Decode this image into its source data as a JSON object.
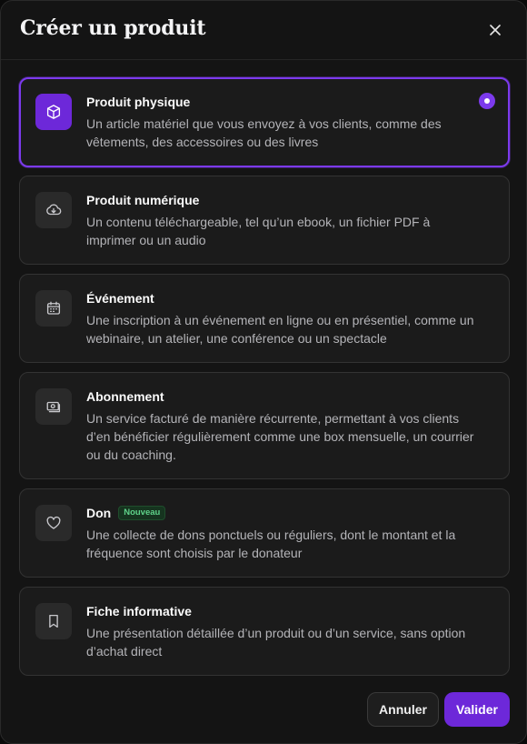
{
  "dialog": {
    "title": "Créer un produit"
  },
  "options": [
    {
      "title": "Produit physique",
      "description": "Un article matériel que vous envoyez à vos clients, comme des vêtements, des accessoires ou des livres",
      "icon": "cube-icon",
      "selected": true
    },
    {
      "title": "Produit numérique",
      "description": "Un contenu téléchargeable, tel qu’un ebook, un fichier PDF à imprimer ou un audio",
      "icon": "cloud-download-icon",
      "selected": false
    },
    {
      "title": "Événement",
      "description": "Une inscription à un événement en ligne ou en présentiel, comme un webinaire, un atelier, une conférence ou un spectacle",
      "icon": "calendar-icon",
      "selected": false
    },
    {
      "title": "Abonnement",
      "description": "Un service facturé de manière récurrente, permettant à vos clients d’en bénéficier régulièrement comme une box mensuelle, un courrier ou du coaching.",
      "icon": "money-icon",
      "selected": false
    },
    {
      "title": "Don",
      "badge": "Nouveau",
      "description": "Une collecte de dons ponctuels ou réguliers, dont le montant et la fréquence sont choisis par le donateur",
      "icon": "heart-icon",
      "selected": false
    },
    {
      "title": "Fiche informative",
      "description": "Une présentation détaillée d’un produit ou d’un service, sans option d’achat direct",
      "icon": "bookmark-icon",
      "selected": false
    }
  ],
  "footer": {
    "cancel_label": "Annuler",
    "confirm_label": "Valider"
  },
  "colors": {
    "accent": "#7c3aed",
    "badge_text": "#5fd38a"
  }
}
